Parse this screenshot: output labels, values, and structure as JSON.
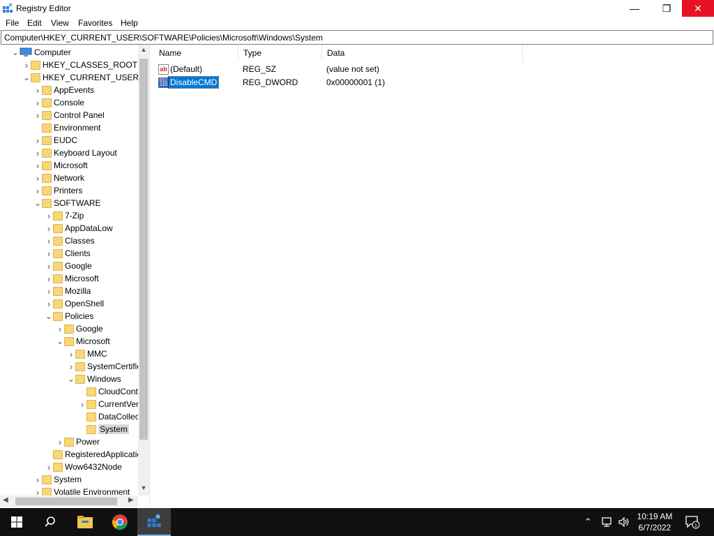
{
  "window": {
    "title": "Registry Editor"
  },
  "window_controls": {
    "minimize": "—",
    "maximize": "❐",
    "close": "✕"
  },
  "menu": [
    "File",
    "Edit",
    "View",
    "Favorites",
    "Help"
  ],
  "address": "Computer\\HKEY_CURRENT_USER\\SOFTWARE\\Policies\\Microsoft\\Windows\\System",
  "tree": [
    {
      "label": "Computer",
      "level": 0,
      "chevron": "v",
      "icon": "computer-icon"
    },
    {
      "label": "HKEY_CLASSES_ROOT",
      "level": 1,
      "chevron": ">"
    },
    {
      "label": "HKEY_CURRENT_USER",
      "level": 1,
      "chevron": "v"
    },
    {
      "label": "AppEvents",
      "level": 2,
      "chevron": ">"
    },
    {
      "label": "Console",
      "level": 2,
      "chevron": ">"
    },
    {
      "label": "Control Panel",
      "level": 2,
      "chevron": ">"
    },
    {
      "label": "Environment",
      "level": 2,
      "chevron": ""
    },
    {
      "label": "EUDC",
      "level": 2,
      "chevron": ">"
    },
    {
      "label": "Keyboard Layout",
      "level": 2,
      "chevron": ">"
    },
    {
      "label": "Microsoft",
      "level": 2,
      "chevron": ">"
    },
    {
      "label": "Network",
      "level": 2,
      "chevron": ">"
    },
    {
      "label": "Printers",
      "level": 2,
      "chevron": ">"
    },
    {
      "label": "SOFTWARE",
      "level": 2,
      "chevron": "v"
    },
    {
      "label": "7-Zip",
      "level": 3,
      "chevron": ">"
    },
    {
      "label": "AppDataLow",
      "level": 3,
      "chevron": ">"
    },
    {
      "label": "Classes",
      "level": 3,
      "chevron": ">"
    },
    {
      "label": "Clients",
      "level": 3,
      "chevron": ">"
    },
    {
      "label": "Google",
      "level": 3,
      "chevron": ">"
    },
    {
      "label": "Microsoft",
      "level": 3,
      "chevron": ">"
    },
    {
      "label": "Mozilla",
      "level": 3,
      "chevron": ">"
    },
    {
      "label": "OpenShell",
      "level": 3,
      "chevron": ">"
    },
    {
      "label": "Policies",
      "level": 3,
      "chevron": "v"
    },
    {
      "label": "Google",
      "level": 4,
      "chevron": ">"
    },
    {
      "label": "Microsoft",
      "level": 4,
      "chevron": "v"
    },
    {
      "label": "MMC",
      "level": 5,
      "chevron": ">"
    },
    {
      "label": "SystemCertifica",
      "level": 5,
      "chevron": ">"
    },
    {
      "label": "Windows",
      "level": 5,
      "chevron": "v"
    },
    {
      "label": "CloudConter",
      "level": 6,
      "chevron": ""
    },
    {
      "label": "CurrentVersio",
      "level": 6,
      "chevron": ">"
    },
    {
      "label": "DataCollectio",
      "level": 6,
      "chevron": ""
    },
    {
      "label": "System",
      "level": 6,
      "chevron": "",
      "selected": true
    },
    {
      "label": "Power",
      "level": 4,
      "chevron": ">"
    },
    {
      "label": "RegisteredApplication",
      "level": 3,
      "chevron": ""
    },
    {
      "label": "Wow6432Node",
      "level": 3,
      "chevron": ">"
    },
    {
      "label": "System",
      "level": 2,
      "chevron": ">"
    },
    {
      "label": "Volatile Environment",
      "level": 2,
      "chevron": ">"
    }
  ],
  "list": {
    "columns": [
      "Name",
      "Type",
      "Data"
    ],
    "rows": [
      {
        "name": "(Default)",
        "type": "REG_SZ",
        "data": "(value not set)",
        "icon": "string-value-icon"
      },
      {
        "name": "DisableCMD",
        "type": "REG_DWORD",
        "data": "0x00000001 (1)",
        "icon": "dword-value-icon",
        "selected": true
      }
    ]
  },
  "taskbar": {
    "apps": [
      "start-icon",
      "search-icon",
      "file-explorer-icon",
      "chrome-icon",
      "registry-editor-icon"
    ],
    "clock_time": "10:19 AM",
    "clock_date": "6/7/2022",
    "notification_count": "1"
  }
}
